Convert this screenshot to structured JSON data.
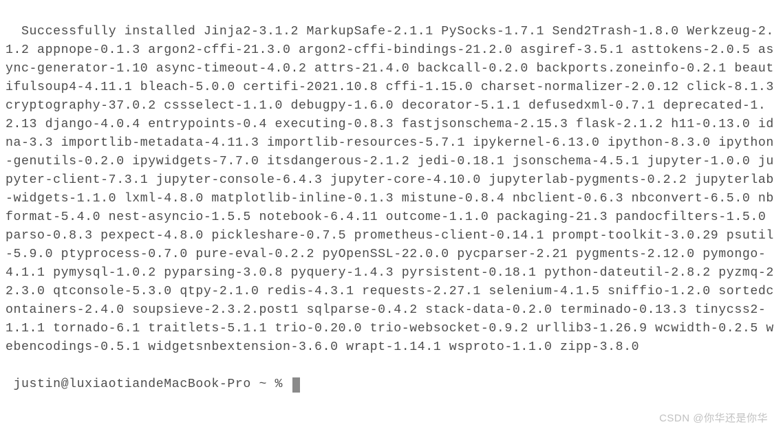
{
  "terminal": {
    "output": "Successfully installed Jinja2-3.1.2 MarkupSafe-2.1.1 PySocks-1.7.1 Send2Trash-1.8.0 Werkzeug-2.1.2 appnope-0.1.3 argon2-cffi-21.3.0 argon2-cffi-bindings-21.2.0 asgiref-3.5.1 asttokens-2.0.5 async-generator-1.10 async-timeout-4.0.2 attrs-21.4.0 backcall-0.2.0 backports.zoneinfo-0.2.1 beautifulsoup4-4.11.1 bleach-5.0.0 certifi-2021.10.8 cffi-1.15.0 charset-normalizer-2.0.12 click-8.1.3 cryptography-37.0.2 cssselect-1.1.0 debugpy-1.6.0 decorator-5.1.1 defusedxml-0.7.1 deprecated-1.2.13 django-4.0.4 entrypoints-0.4 executing-0.8.3 fastjsonschema-2.15.3 flask-2.1.2 h11-0.13.0 idna-3.3 importlib-metadata-4.11.3 importlib-resources-5.7.1 ipykernel-6.13.0 ipython-8.3.0 ipython-genutils-0.2.0 ipywidgets-7.7.0 itsdangerous-2.1.2 jedi-0.18.1 jsonschema-4.5.1 jupyter-1.0.0 jupyter-client-7.3.1 jupyter-console-6.4.3 jupyter-core-4.10.0 jupyterlab-pygments-0.2.2 jupyterlab-widgets-1.1.0 lxml-4.8.0 matplotlib-inline-0.1.3 mistune-0.8.4 nbclient-0.6.3 nbconvert-6.5.0 nbformat-5.4.0 nest-asyncio-1.5.5 notebook-6.4.11 outcome-1.1.0 packaging-21.3 pandocfilters-1.5.0 parso-0.8.3 pexpect-4.8.0 pickleshare-0.7.5 prometheus-client-0.14.1 prompt-toolkit-3.0.29 psutil-5.9.0 ptyprocess-0.7.0 pure-eval-0.2.2 pyOpenSSL-22.0.0 pycparser-2.21 pygments-2.12.0 pymongo-4.1.1 pymysql-1.0.2 pyparsing-3.0.8 pyquery-1.4.3 pyrsistent-0.18.1 python-dateutil-2.8.2 pyzmq-22.3.0 qtconsole-5.3.0 qtpy-2.1.0 redis-4.3.1 requests-2.27.1 selenium-4.1.5 sniffio-1.2.0 sortedcontainers-2.4.0 soupsieve-2.3.2.post1 sqlparse-0.4.2 stack-data-0.2.0 terminado-0.13.3 tinycss2-1.1.1 tornado-6.1 traitlets-5.1.1 trio-0.20.0 trio-websocket-0.9.2 urllib3-1.26.9 wcwidth-0.2.5 webencodings-0.5.1 widgetsnbextension-3.6.0 wrapt-1.14.1 wsproto-1.1.0 zipp-3.8.0",
    "prompt": " justin@luxiaotiandeMacBook-Pro ~ % "
  },
  "watermark": "CSDN @你华还是你华"
}
